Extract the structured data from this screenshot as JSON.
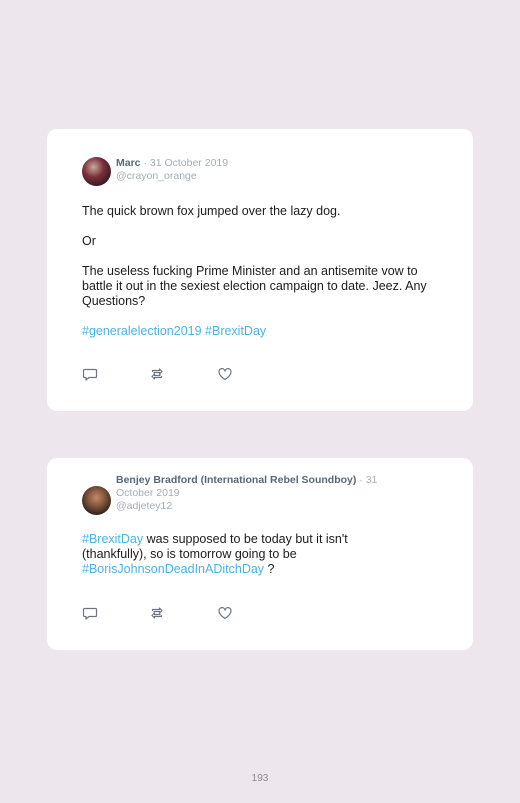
{
  "tweets": [
    {
      "name": "Marc",
      "separator": "·",
      "date": "31 October 2019",
      "handle": "@crayon_orange",
      "paragraphs": [
        "The quick brown fox jumped over the lazy dog.",
        "Or",
        "The useless fucking Prime Minister and an antisemite vow to battle it out in the sexiest election campaign to date. Jeez. Any Questions?"
      ],
      "hashtags": [
        "#generalelection2019",
        "#BrexitDay"
      ]
    },
    {
      "name": "Benjey Bradford (International Rebel Soundboy)",
      "separator": "·",
      "date": "31 October 2019",
      "handle": "@adjetey12",
      "segments": [
        "#BrexitDay",
        " was supposed to be today but it isn't (thankfully), so is tomorrow going to be ",
        "#BorisJohnsonDeadInADitchDay",
        " ?"
      ]
    }
  ],
  "icons": {
    "reply": "reply-icon",
    "retweet": "retweet-icon",
    "like": "like-icon"
  },
  "colors": {
    "background": "#ede6ed",
    "card": "#ffffff",
    "hashtag": "#4ab3e6",
    "name": "#596877",
    "muted": "#a3adb6"
  },
  "page_number": "193"
}
